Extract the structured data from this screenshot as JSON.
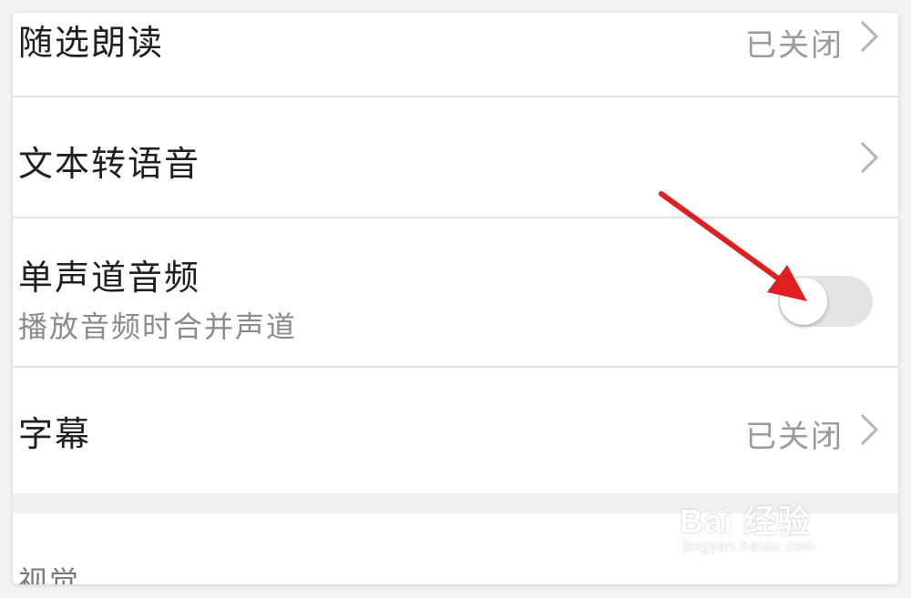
{
  "settings": {
    "items": [
      {
        "title": "随选朗读",
        "value": "已关闭"
      },
      {
        "title": "文本转语音"
      },
      {
        "title": "单声道音频",
        "subtitle": "播放音频时合并声道",
        "toggle": "off"
      },
      {
        "title": "字幕",
        "value": "已关闭"
      }
    ],
    "section_label": "视觉"
  },
  "icons": {
    "chevron": "chevron-right-icon",
    "annotation": "red-arrow-icon"
  },
  "colors": {
    "arrow": "#e02020",
    "toggle_track": "#e4e4e4",
    "text_primary": "#1f1f1f",
    "text_secondary": "#9a9a9a"
  },
  "watermark": {
    "logo_text": "Bai 经验",
    "url": "jingyan.baidu.com"
  }
}
